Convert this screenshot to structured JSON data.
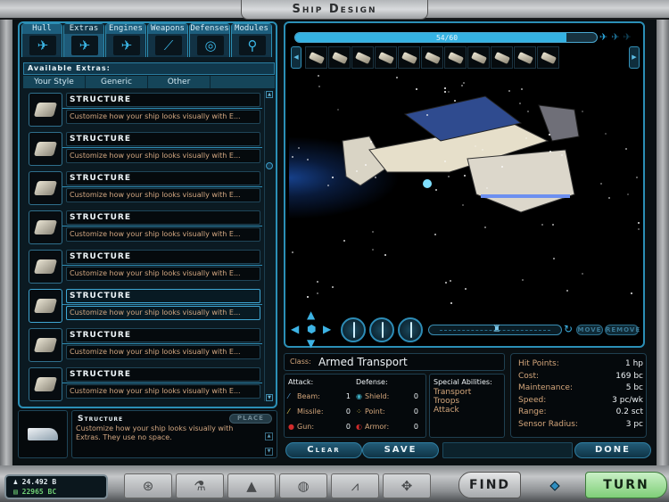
{
  "window": {
    "title": "Ship Design"
  },
  "tabs": [
    {
      "label": "Hull",
      "icon": "hull-icon",
      "glyph": "✈"
    },
    {
      "label": "Extras",
      "icon": "extras-icon",
      "glyph": "✈",
      "active": true
    },
    {
      "label": "Engines",
      "icon": "engines-icon",
      "glyph": "✈"
    },
    {
      "label": "Weapons",
      "icon": "weapons-icon",
      "glyph": "⟋"
    },
    {
      "label": "Defenses",
      "icon": "defenses-icon",
      "glyph": "◎"
    },
    {
      "label": "Modules",
      "icon": "modules-icon",
      "glyph": "⚲"
    }
  ],
  "available": {
    "header": "Available Extras:",
    "subtabs": [
      "Your Style",
      "Generic",
      "Other"
    ],
    "items": [
      {
        "name": "Structure",
        "desc": "Customize how your ship looks visually with E..."
      },
      {
        "name": "Structure",
        "desc": "Customize how your ship looks visually with E..."
      },
      {
        "name": "Structure",
        "desc": "Customize how your ship looks visually with E..."
      },
      {
        "name": "Structure",
        "desc": "Customize how your ship looks visually with E..."
      },
      {
        "name": "Structure",
        "desc": "Customize how your ship looks visually with E..."
      },
      {
        "name": "Structure",
        "desc": "Customize how your ship looks visually with E...",
        "selected": true
      },
      {
        "name": "Structure",
        "desc": "Customize how your ship looks visually with E..."
      },
      {
        "name": "Structure",
        "desc": "Customize how your ship looks visually with E..."
      }
    ]
  },
  "detail": {
    "name": "Structure",
    "desc": "Customize how your ship looks visually with Extras. They use no space.",
    "place_label": "Place"
  },
  "viewport": {
    "space_used": 54,
    "space_total": 60,
    "space_text": "54/60",
    "hull_count": 11,
    "move_label": "Move",
    "remove_label": "Remove",
    "zoom_position": 0.5
  },
  "ship": {
    "class_label": "Class:",
    "class_value": "Armed Transport",
    "attack_header": "Attack:",
    "defense_header": "Defense:",
    "attack": [
      {
        "label": "Beam:",
        "value": "1",
        "icon": "beam-icon",
        "color": "#5aa7e0",
        "glyph": "⁄"
      },
      {
        "label": "Missile:",
        "value": "0",
        "icon": "missile-icon",
        "color": "#e8d257",
        "glyph": "⁄"
      },
      {
        "label": "Gun:",
        "value": "0",
        "icon": "gun-icon",
        "color": "#d12b2b",
        "glyph": "●"
      }
    ],
    "defense": [
      {
        "label": "Shield:",
        "value": "0",
        "icon": "shield-icon",
        "color": "#3fb0c6",
        "glyph": "◉"
      },
      {
        "label": "Point:",
        "value": "0",
        "icon": "point-defense-icon",
        "color": "#d8c24a",
        "glyph": "⁘"
      },
      {
        "label": "Armor:",
        "value": "0",
        "icon": "armor-icon",
        "color": "#d12b2b",
        "glyph": "◐"
      }
    ],
    "special_header": "Special Abilities:",
    "special": [
      "Transport",
      "Troops",
      "Attack"
    ],
    "stats": [
      {
        "label": "Hit Points:",
        "value": "1 hp"
      },
      {
        "label": "Cost:",
        "value": "169 bc"
      },
      {
        "label": "Maintenance:",
        "value": "5 bc"
      },
      {
        "label": "Speed:",
        "value": "3 pc/wk"
      },
      {
        "label": "Range:",
        "value": "0.2 sct"
      },
      {
        "label": "Sensor Radius:",
        "value": "3 pc"
      }
    ]
  },
  "actions": {
    "clear": "Clear",
    "save": "Save",
    "done": "Done"
  },
  "bottom": {
    "population": "24.492 B",
    "treasury": "22965 BC",
    "nav": [
      {
        "name": "planets-button",
        "glyph": "⊛"
      },
      {
        "name": "research-button",
        "glyph": "⚗"
      },
      {
        "name": "build-button",
        "glyph": "▲"
      },
      {
        "name": "diplomacy-button",
        "glyph": "◍"
      },
      {
        "name": "graphs-button",
        "glyph": "⩘"
      },
      {
        "name": "ship-design-button",
        "glyph": "✥"
      }
    ],
    "find": "Find",
    "turn": "Turn"
  },
  "colors": {
    "accent": "#2b8fb6",
    "bar_fill": "#35b2e2",
    "label": "#d5a77c",
    "turn": "#7fcf78",
    "treasury": "#6fcf74"
  }
}
